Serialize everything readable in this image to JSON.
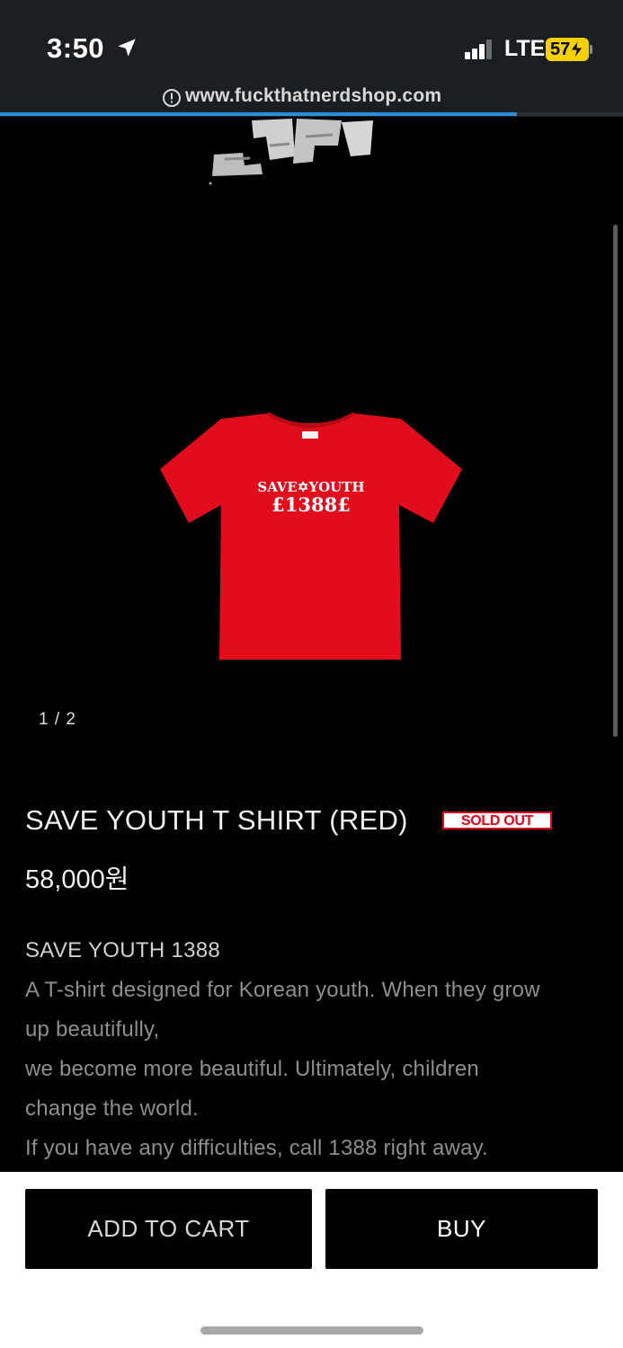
{
  "status_bar": {
    "time": "3:50",
    "network": "LTE",
    "battery": "57",
    "accent_battery": "#f5d104"
  },
  "browser": {
    "url": "www.fuckthatnerdshop.com",
    "load_progress": 0.83,
    "progress_color": "#2f8fd8"
  },
  "gallery": {
    "counter": "1 / 2",
    "current": 1,
    "total": 2,
    "print_line1": "SAVE✡YOUTH",
    "print_line2": "£1388£"
  },
  "product": {
    "title": "SAVE YOUTH T SHIRT (RED)",
    "badge": "SOLD OUT",
    "price": "58,000원",
    "desc_heading": "SAVE YOUTH 1388",
    "desc_lines": [
      "A T-shirt designed for Korean youth. When they grow",
      "up beautifully,",
      "we become more beautiful. Ultimately, children",
      "change the world.",
      "If you have any difficulties, call 1388 right away."
    ]
  },
  "actions": {
    "add_to_cart": "ADD TO CART",
    "buy": "BUY"
  },
  "colors": {
    "shirt": "#e10d1c",
    "badge": "#e2001a"
  }
}
